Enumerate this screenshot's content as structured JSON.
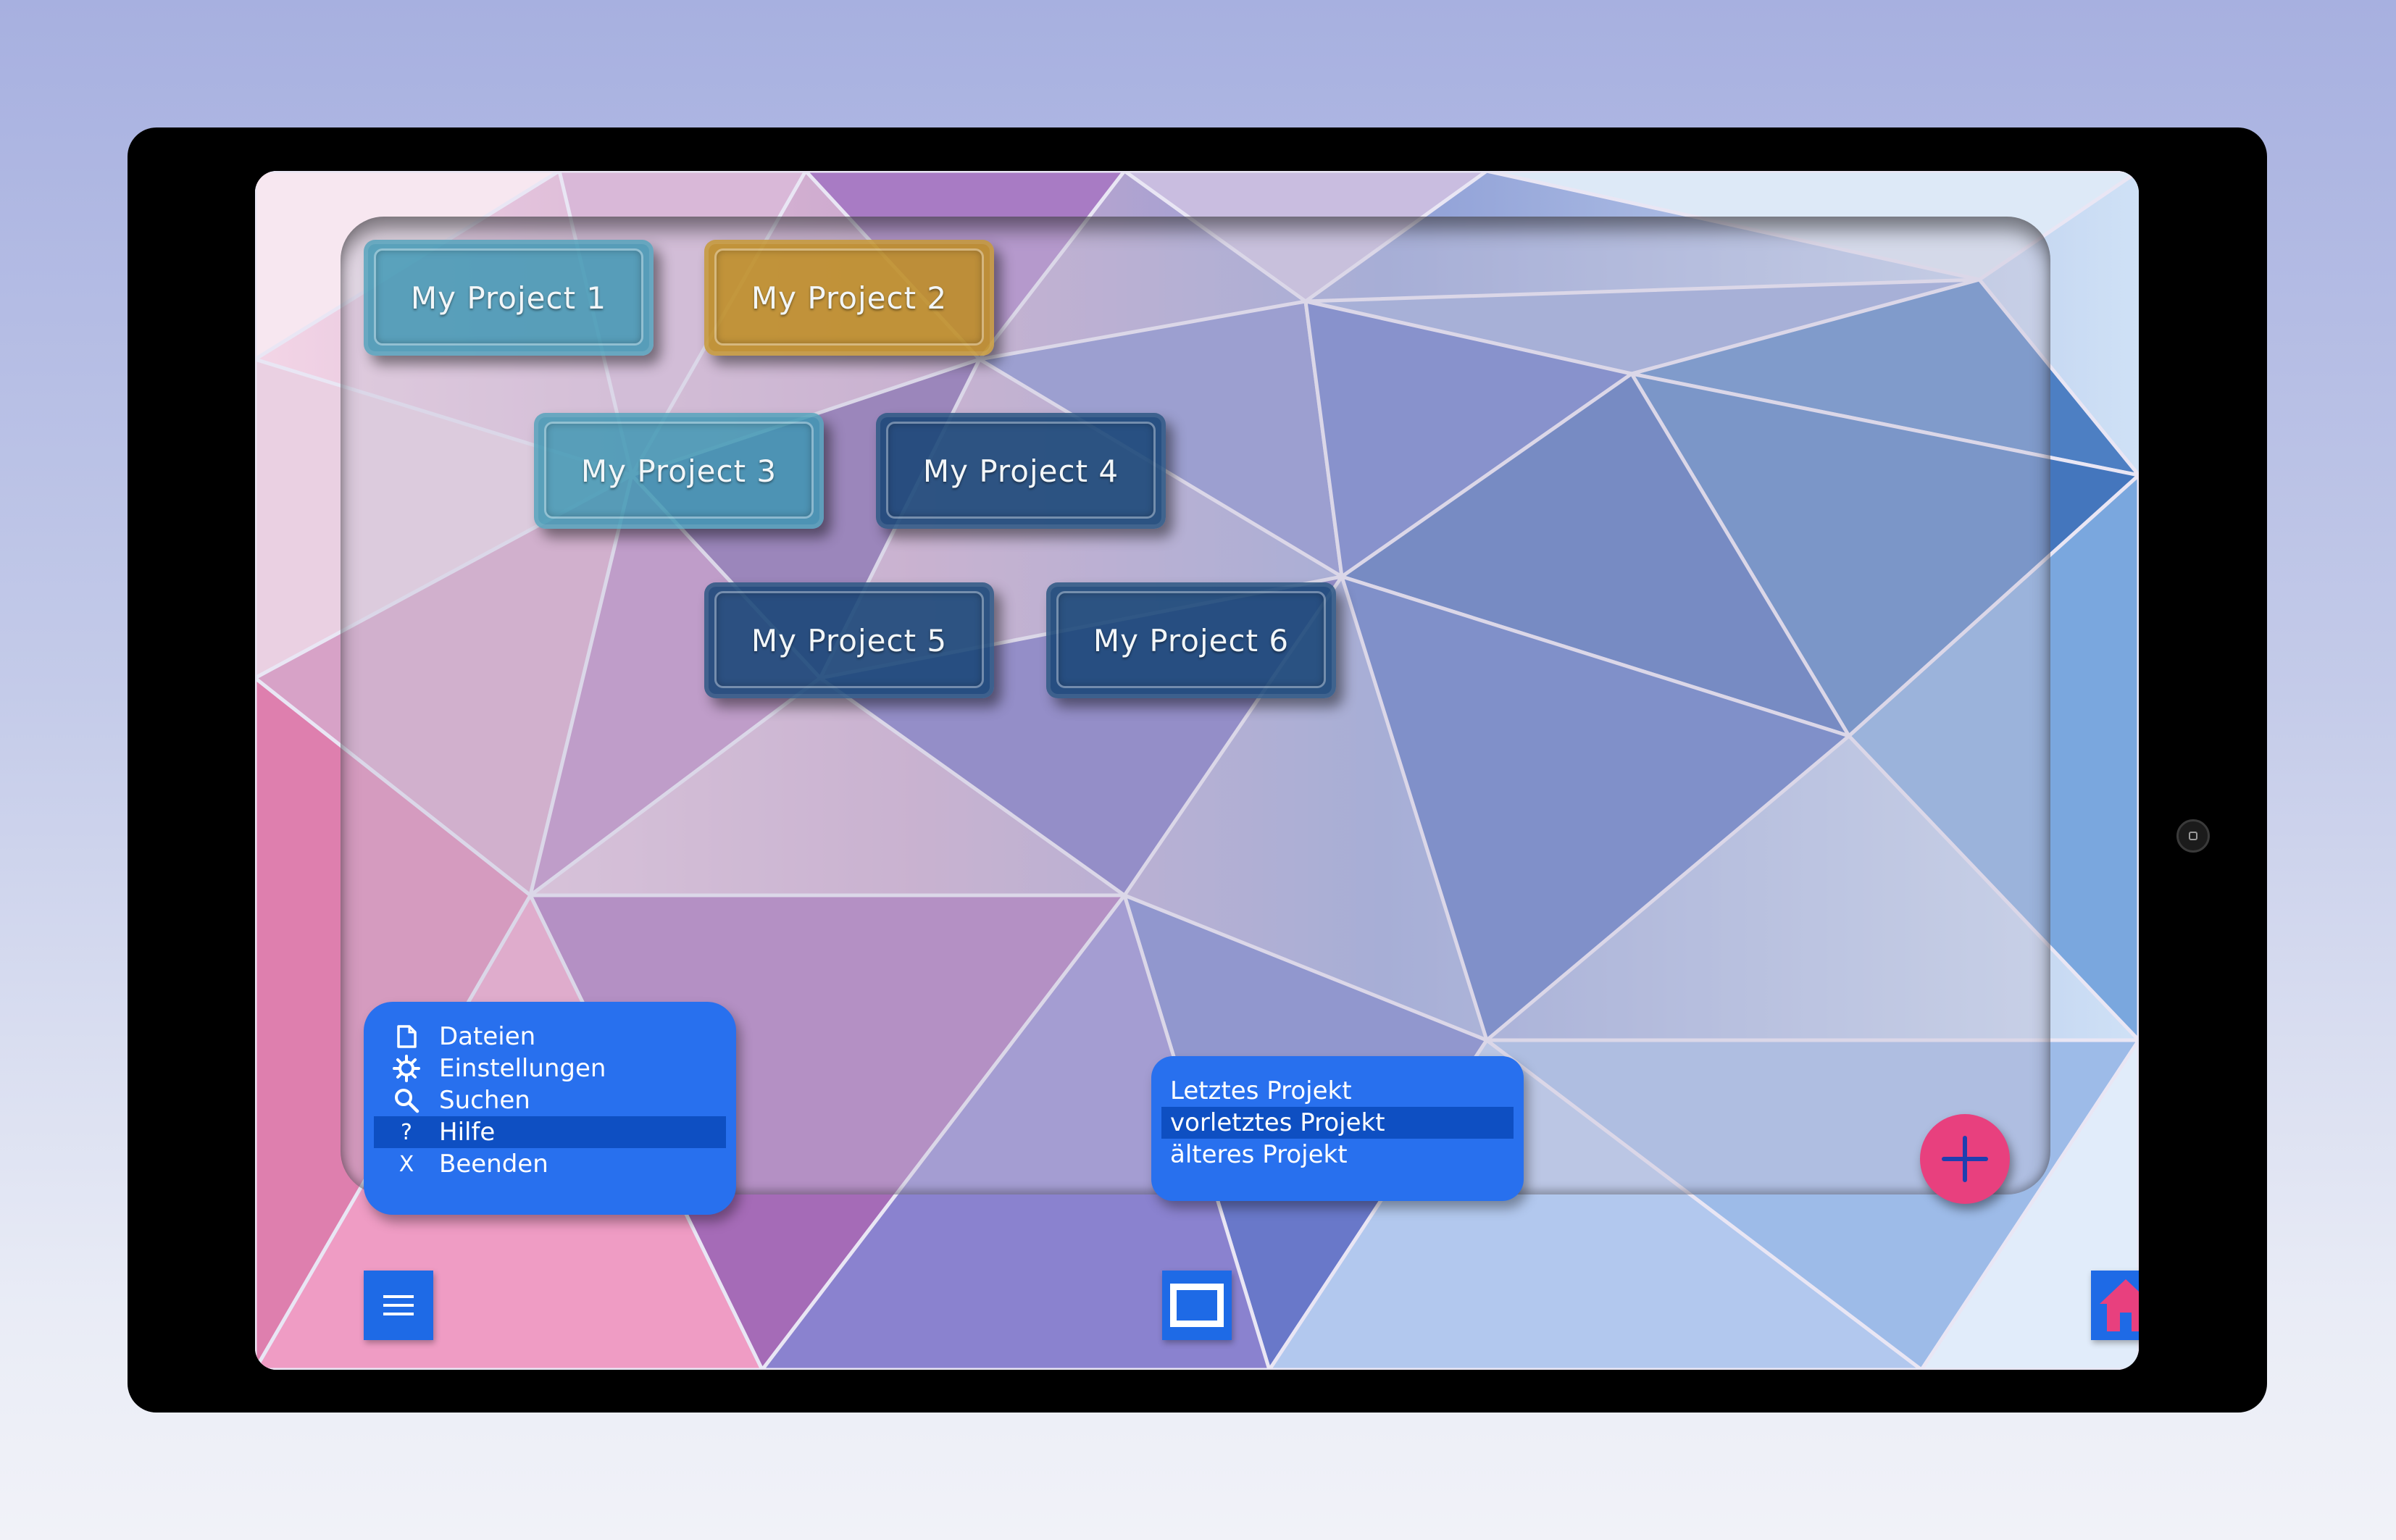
{
  "projects": [
    {
      "label": "My Project 1",
      "style": "teal"
    },
    {
      "label": "My Project 2",
      "style": "gold"
    },
    {
      "label": "My Project 3",
      "style": "teal"
    },
    {
      "label": "My Project 4",
      "style": "navy"
    },
    {
      "label": "My Project 5",
      "style": "navy"
    },
    {
      "label": "My Project 6",
      "style": "navy"
    }
  ],
  "menu": {
    "items": [
      {
        "icon": "file-icon",
        "label": "Dateien"
      },
      {
        "icon": "gear-icon",
        "label": "Einstellungen"
      },
      {
        "icon": "search-icon",
        "label": "Suchen"
      },
      {
        "icon": "help-icon",
        "glyph": "?",
        "label": "Hilfe",
        "selected": true
      },
      {
        "icon": "close-icon",
        "glyph": "X",
        "label": "Beenden"
      }
    ]
  },
  "recent": {
    "items": [
      {
        "label": "Letztes Projekt"
      },
      {
        "label": "vorletztes Projekt",
        "selected": true
      },
      {
        "label": "älteres Projekt"
      }
    ]
  },
  "toolbar": {
    "menu_icon": "hamburger-menu-icon",
    "window_icon": "window-icon",
    "home_icon": "home-icon",
    "add_icon": "plus-icon"
  },
  "colors": {
    "menu_bg": "#2870ee",
    "menu_selected": "#0e4fc2",
    "fab": "#e8407e",
    "home_roof": "#e8407e",
    "teal_button": "#3c96b2",
    "navy_button": "#184676",
    "gold_button": "#be8c1e"
  }
}
